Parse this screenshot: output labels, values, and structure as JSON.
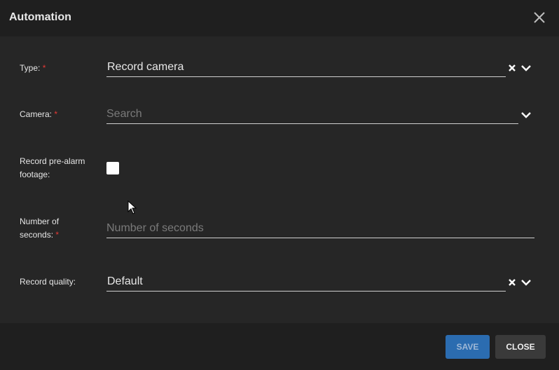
{
  "dialog": {
    "title": "Automation",
    "close_icon": "close-icon"
  },
  "form": {
    "type": {
      "label": "Type:",
      "required_mark": "*",
      "value": "Record camera"
    },
    "camera": {
      "label": "Camera:",
      "required_mark": "*",
      "placeholder": "Search"
    },
    "pre_alarm": {
      "label_line1": "Record pre-alarm",
      "label_line2": "footage:",
      "checked": false
    },
    "seconds": {
      "label_line1": "Number of",
      "label_line2": "seconds:",
      "required_mark": "*",
      "placeholder": "Number of seconds"
    },
    "quality": {
      "label": "Record quality:",
      "value": "Default"
    }
  },
  "footer": {
    "save_label": "SAVE",
    "close_label": "CLOSE"
  },
  "colors": {
    "accent": "#2b6cb0",
    "required": "#e53935",
    "background": "#262626"
  }
}
